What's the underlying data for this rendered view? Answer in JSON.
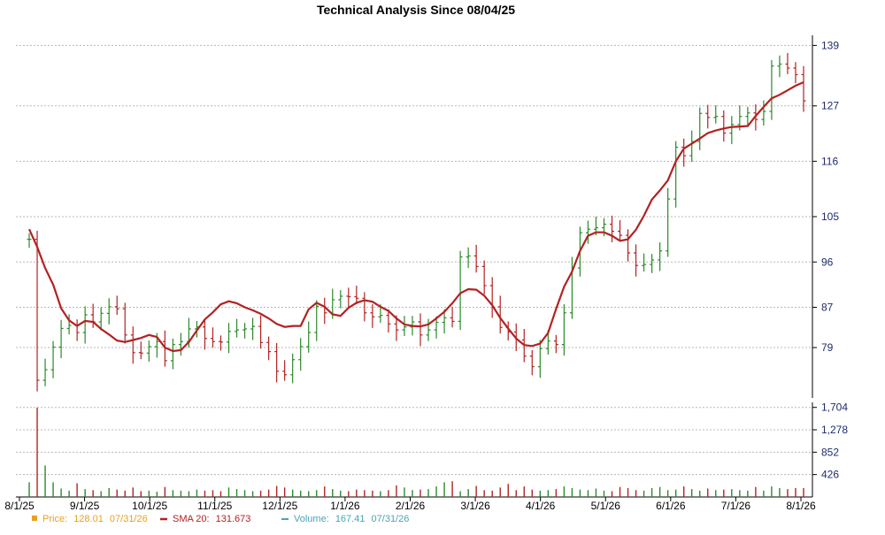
{
  "chart_data": [
    {
      "type": "ohlc",
      "title": "Technical Analysis Since 08/04/25",
      "x_tick_labels": [
        "8/1/25",
        "9/1/25",
        "10/1/25",
        "11/1/25",
        "12/1/25",
        "1/1/26",
        "2/1/26",
        "3/1/26",
        "4/1/26",
        "5/1/26",
        "6/1/26",
        "7/1/26",
        "8/1/26"
      ],
      "y_tick_labels": [
        "139",
        "127",
        "116",
        "105",
        "96",
        "87",
        "79"
      ],
      "ylim": [
        69,
        141
      ],
      "grid": true,
      "series": [
        {
          "name": "Price",
          "color_up": "#2a8a2a",
          "color_down": "#b22222",
          "close": [
            100.5,
            72.5,
            74.6,
            79.1,
            82.8,
            83.4,
            82.0,
            85.5,
            84.1,
            85.8,
            87.1,
            86.7,
            81.5,
            78.0,
            77.9,
            79.2,
            80.2,
            76.4,
            79.6,
            80.2,
            82.7,
            83.1,
            80.8,
            80.2,
            80.1,
            82.2,
            82.5,
            82.7,
            83.2,
            80.0,
            78.2,
            74.3,
            73.6,
            76.6,
            79.2,
            82.0,
            87.2,
            85.9,
            88.5,
            89.2,
            89.1,
            88.8,
            85.9,
            85.1,
            85.4,
            83.7,
            82.5,
            83.1,
            84.1,
            81.5,
            82.5,
            84.0,
            84.9,
            84.2,
            97.0,
            97.2,
            95.1,
            91.3,
            87.1,
            83.0,
            82.1,
            80.5,
            77.3,
            75.2,
            78.8,
            80.3,
            79.6,
            85.9,
            94.8,
            101.8,
            102.5,
            102.8,
            103.5,
            102.1,
            101.3,
            97.8,
            95.3,
            95.5,
            96.4,
            98.2,
            108.5,
            118.8,
            117.1,
            119.9,
            125.5,
            124.7,
            124.9,
            121.6,
            123.3,
            124.9,
            125.6,
            124.3,
            125.9,
            134.9,
            135.3,
            134.5,
            133.2,
            128.0
          ]
        },
        {
          "name": "SMA 20",
          "color": "#b22222",
          "values": [
            102.5,
            99.0,
            94.8,
            91.5,
            86.8,
            84.4,
            83.3,
            84.3,
            84.1,
            82.7,
            81.6,
            80.4,
            80.1,
            80.5,
            80.9,
            81.5,
            81.1,
            79.0,
            78.3,
            78.5,
            80.1,
            82.4,
            84.6,
            86.0,
            87.6,
            88.2,
            87.8,
            87.0,
            86.4,
            85.7,
            84.8,
            83.7,
            83.1,
            83.3,
            83.3,
            86.6,
            87.9,
            87.1,
            85.6,
            85.3,
            86.9,
            87.9,
            88.4,
            88.1,
            87.1,
            86.3,
            84.8,
            83.6,
            83.3,
            83.2,
            83.6,
            84.8,
            86.1,
            87.8,
            89.8,
            90.6,
            90.5,
            89.3,
            87.4,
            84.9,
            82.8,
            80.8,
            79.5,
            79.3,
            79.8,
            81.9,
            86.7,
            91.1,
            94.1,
            98.2,
            101.2,
            101.9,
            101.9,
            101.2,
            100.2,
            100.5,
            102.4,
            105.2,
            108.4,
            110.2,
            112.2,
            116.0,
            118.5,
            119.5,
            120.5,
            121.6,
            122.1,
            122.5,
            122.8,
            122.9,
            123.0,
            125.0,
            126.8,
            128.5,
            129.2,
            130.1,
            131.0,
            131.7
          ]
        }
      ],
      "legend": [
        {
          "label": "Price:",
          "value": "128.01",
          "date": "07/31/26",
          "color": "#e8a020",
          "marker": "square"
        },
        {
          "label": "SMA 20:",
          "value": "131.673",
          "date": "",
          "color": "#b22222",
          "marker": "line"
        },
        {
          "label": "Volume:",
          "value": "167.41",
          "date": "07/31/26",
          "color": "#4aa3b5",
          "marker": "line"
        }
      ],
      "legend_placement": "bottom-left"
    },
    {
      "type": "bar",
      "name": "Volume",
      "y_tick_labels": [
        "1,704",
        "1,278",
        "852",
        "426"
      ],
      "ylim": [
        0,
        1800
      ],
      "values": [
        280,
        1700,
        600,
        280,
        160,
        120,
        260,
        150,
        130,
        110,
        170,
        140,
        120,
        180,
        110,
        120,
        100,
        190,
        130,
        120,
        110,
        140,
        120,
        130,
        110,
        180,
        150,
        130,
        110,
        120,
        140,
        210,
        180,
        140,
        120,
        110,
        130,
        200,
        150,
        120,
        110,
        140,
        130,
        120,
        110,
        130,
        220,
        180,
        130,
        140,
        150,
        200,
        280,
        300,
        110,
        150,
        210,
        130,
        120,
        180,
        250,
        130,
        200,
        140,
        120,
        130,
        150,
        200,
        170,
        140,
        130,
        160,
        120,
        110,
        190,
        170,
        130,
        120,
        170,
        190,
        130,
        140,
        200,
        150,
        120,
        160,
        130,
        140,
        150,
        130,
        120,
        190,
        120,
        200,
        170,
        150,
        170,
        170
      ],
      "color": "#2a8a2a"
    }
  ]
}
